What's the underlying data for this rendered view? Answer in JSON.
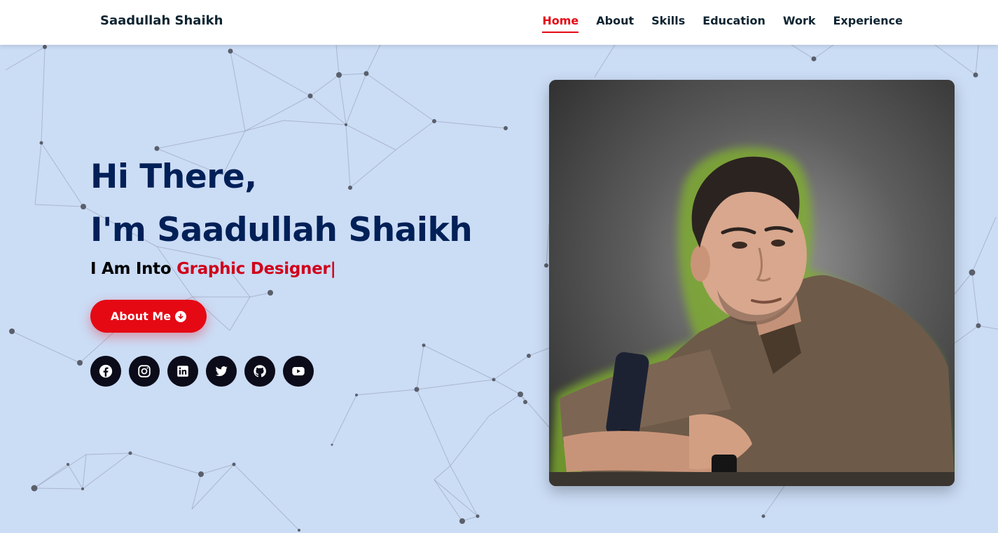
{
  "nav": {
    "brand": "Saadullah Shaikh",
    "links": [
      {
        "label": "Home",
        "active": true
      },
      {
        "label": "About",
        "active": false
      },
      {
        "label": "Skills",
        "active": false
      },
      {
        "label": "Education",
        "active": false
      },
      {
        "label": "Work",
        "active": false
      },
      {
        "label": "Experience",
        "active": false
      }
    ]
  },
  "hero": {
    "greeting": "Hi There,",
    "intro": "I'm Saadullah Shaikh",
    "typing_prefix": "I Am Into ",
    "typing_role": "Graphic Designer",
    "typing_cursor": "|",
    "button_label": "About Me",
    "button_icon": "arrow-circle-down-icon"
  },
  "socials": [
    {
      "name": "facebook-icon"
    },
    {
      "name": "instagram-icon"
    },
    {
      "name": "linkedin-icon"
    },
    {
      "name": "twitter-icon"
    },
    {
      "name": "github-icon"
    },
    {
      "name": "youtube-icon"
    }
  ],
  "colors": {
    "accent": "#e50914",
    "heading": "#002057",
    "background": "#cbdcf5",
    "nav_text": "#0e2431",
    "social_bg": "#0b0b19"
  }
}
